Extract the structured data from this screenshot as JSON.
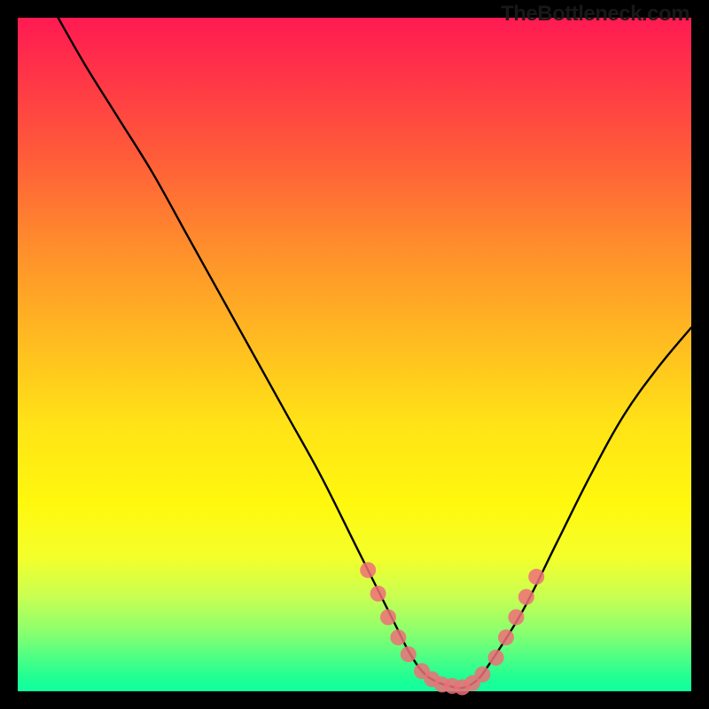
{
  "watermark": "TheBottleneck.com",
  "chart_data": {
    "type": "line",
    "title": "",
    "xlabel": "",
    "ylabel": "",
    "xlim": [
      0,
      100
    ],
    "ylim": [
      0,
      100
    ],
    "grid": false,
    "legend": false,
    "series": [
      {
        "name": "bottleneck-curve",
        "x": [
          6,
          10,
          15,
          20,
          25,
          30,
          35,
          40,
          45,
          50,
          52,
          54,
          56,
          58,
          60,
          62,
          64,
          66,
          68,
          70,
          75,
          80,
          85,
          90,
          95,
          100
        ],
        "y": [
          100,
          93,
          85,
          77,
          68,
          59,
          50,
          41,
          32,
          22,
          18,
          14,
          10,
          6,
          3,
          1.5,
          0.8,
          0.5,
          1.5,
          4,
          12,
          22,
          32,
          41,
          48,
          54
        ]
      }
    ],
    "markers": [
      {
        "name": "highlight-gpus",
        "color": "#ef6f78",
        "radius": 9,
        "points": [
          {
            "x": 52,
            "y": 18
          },
          {
            "x": 53.5,
            "y": 14.5
          },
          {
            "x": 55,
            "y": 11
          },
          {
            "x": 56.5,
            "y": 8
          },
          {
            "x": 58,
            "y": 5.5
          },
          {
            "x": 60,
            "y": 3
          },
          {
            "x": 61.5,
            "y": 1.8
          },
          {
            "x": 63,
            "y": 1
          },
          {
            "x": 64.5,
            "y": 0.8
          },
          {
            "x": 66,
            "y": 0.6
          },
          {
            "x": 67.5,
            "y": 1.2
          },
          {
            "x": 69,
            "y": 2.5
          },
          {
            "x": 71,
            "y": 5
          },
          {
            "x": 72.5,
            "y": 8
          },
          {
            "x": 74,
            "y": 11
          },
          {
            "x": 75.5,
            "y": 14
          },
          {
            "x": 77,
            "y": 17
          }
        ]
      }
    ],
    "background_gradient": {
      "direction": "vertical",
      "stops": [
        {
          "pos": 0.0,
          "color": "#ff1a52"
        },
        {
          "pos": 0.08,
          "color": "#ff3348"
        },
        {
          "pos": 0.2,
          "color": "#ff5a3a"
        },
        {
          "pos": 0.33,
          "color": "#ff8a2d"
        },
        {
          "pos": 0.46,
          "color": "#ffb522"
        },
        {
          "pos": 0.6,
          "color": "#ffe217"
        },
        {
          "pos": 0.72,
          "color": "#fff80e"
        },
        {
          "pos": 0.8,
          "color": "#f4ff2a"
        },
        {
          "pos": 0.86,
          "color": "#c8ff52"
        },
        {
          "pos": 0.91,
          "color": "#8dff6d"
        },
        {
          "pos": 0.95,
          "color": "#4dff84"
        },
        {
          "pos": 0.98,
          "color": "#1fff93"
        },
        {
          "pos": 1.0,
          "color": "#0eff9f"
        }
      ]
    }
  }
}
